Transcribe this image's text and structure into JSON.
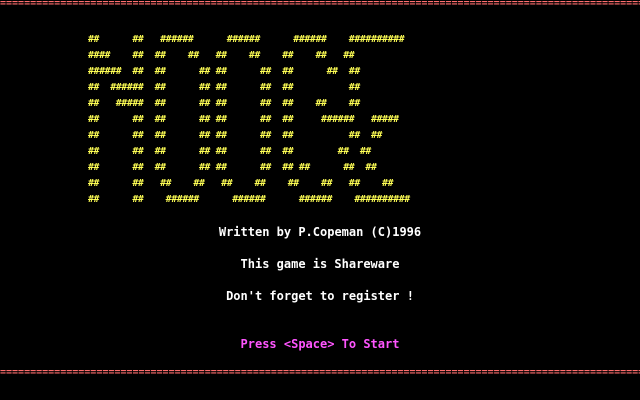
{
  "title_art": {
    "text": "lettering shown below",
    "lines": [
      "##      ##   ######      ######      ######    ##########",
      "####    ##  ##    ##   ##    ##    ##    ##   ##",
      "######  ##  ##      ## ##      ##  ##      ##  ##",
      "##  ######  ##      ## ##      ##  ##          ##",
      "##   #####  ##      ## ##      ##  ##    ##    ##",
      "##      ##  ##      ## ##      ##  ##     ######   #####",
      "##      ##  ##      ## ##      ##  ##          ##  ##",
      "##      ##  ##      ## ##      ##  ##        ##  ##",
      "##      ##  ##      ## ##      ##  ## ##      ##  ##",
      "##      ##   ##    ##   ##    ##    ##    ##   ##    ##",
      "##      ##    ######      ######      ######    ##########"
    ]
  },
  "border": {
    "pattern": "================================================================================================================"
  },
  "credit_text": "Written by P.Copeman (C)1996",
  "shareware_text": "This game is Shareware",
  "register_text": "Don't forget to register !",
  "start_prompt": "Press <Space> To Start",
  "colors": {
    "background": "#000000",
    "logo": "#ffff55",
    "border": "#ff6e6e",
    "text": "#ffffff",
    "prompt": "#ff55ff"
  }
}
